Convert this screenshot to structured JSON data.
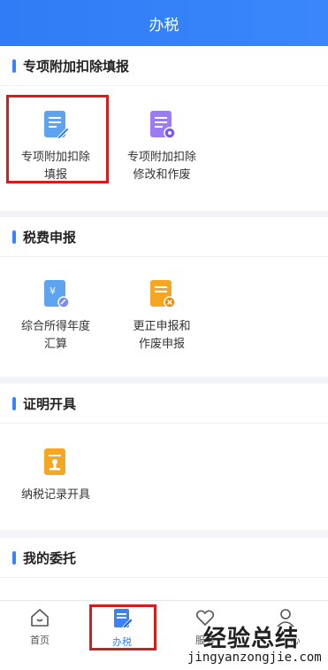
{
  "header": {
    "title": "办税"
  },
  "sections": [
    {
      "title": "专项附加扣除填报",
      "tiles": [
        {
          "label": "专项附加扣除\n填报",
          "icon": "edit-document-icon",
          "color": "#4a90e2"
        },
        {
          "label": "专项附加扣除\n修改和作废",
          "icon": "document-settings-icon",
          "color": "#8e6cf2"
        }
      ]
    },
    {
      "title": "税费申报",
      "tiles": [
        {
          "label": "综合所得年度\n汇算",
          "icon": "yuan-document-icon",
          "color": "#4a90e2"
        },
        {
          "label": "更正申报和\n作废申报",
          "icon": "cancel-document-icon",
          "color": "#f5a623"
        }
      ]
    },
    {
      "title": "证明开具",
      "tiles": [
        {
          "label": "纳税记录开具",
          "icon": "stamp-document-icon",
          "color": "#f5a623"
        }
      ]
    },
    {
      "title": "我的委托",
      "tiles": []
    }
  ],
  "tabbar": [
    {
      "label": "首页",
      "icon": "home-icon",
      "active": false
    },
    {
      "label": "办税",
      "icon": "pen-document-icon",
      "active": true
    },
    {
      "label": "服务",
      "icon": "heart-hand-icon",
      "active": false
    },
    {
      "label": "心",
      "icon": "person-icon",
      "active": false
    }
  ],
  "watermark": {
    "main": "经验总结",
    "sub": "jingyanzongjie.com"
  },
  "colors": {
    "accent": "#3b82f6",
    "highlight": "#d61c1c"
  }
}
